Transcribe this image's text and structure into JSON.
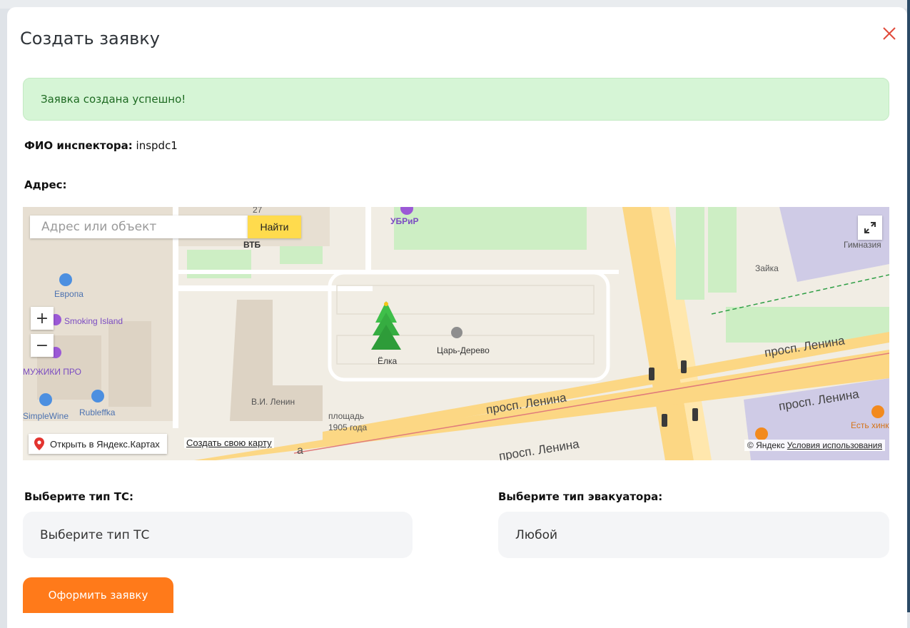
{
  "modal": {
    "title": "Создать заявку",
    "close_icon": "close-icon",
    "success_message": "Заявка создана успешно!",
    "inspector_label": "ФИО инспектора:",
    "inspector_value": "inspdc1",
    "address_label": "Адрес:"
  },
  "map": {
    "search_placeholder": "Адрес или объект",
    "find_button": "Найти",
    "zoom_in": "+",
    "zoom_out": "−",
    "open_in_yandex": "Открыть в Яндекс.Картах",
    "create_map_link": "Создать свою карту",
    "copyright": "© Яндекс",
    "terms_link": "Условия использования",
    "labels": {
      "n27": "27",
      "vtb": "ВТБ",
      "ubrir": "УБРиР",
      "evrona": "Европа",
      "smoking_island": "Smoking Island",
      "muzhiki_pro": "МУЖИКИ ПРО",
      "simplewine": "SimpleWine",
      "rubleffka": "Rubleffka",
      "elka": "Ёлка",
      "tsar_derevo": "Царь-Дерево",
      "v_i_lenin": "В.И. Ленин",
      "ploshchad": "площадь",
      "god1905": "1905 года",
      "prosp_lenina": "просп. Ленина",
      "zaika": "Зайка",
      "gimnaziya": "Гимназия",
      "est_khink": "Есть хинк",
      "street_partial": "а"
    },
    "colors": {
      "land": "#f1ede4",
      "road": "#ffffff",
      "avenue": "#fcd784",
      "park": "#cdeec4",
      "building": "#e7dfd2",
      "violet_building": "#cfcbe6"
    }
  },
  "form": {
    "ts_label": "Выберите тип ТС:",
    "ts_value": "Выберите тип ТС",
    "evac_label": "Выберите тип эвакуатора:",
    "evac_value": "Любой",
    "submit_label": "Оформить заявку"
  },
  "background": {
    "top_text": "                                                  "
  },
  "theme": {
    "accent": "#ff7a1a",
    "success_bg": "#d6f5d6",
    "success_text": "#1e6a22",
    "close_color": "#e14b3b",
    "find_button_bg": "#ffdb4d"
  }
}
